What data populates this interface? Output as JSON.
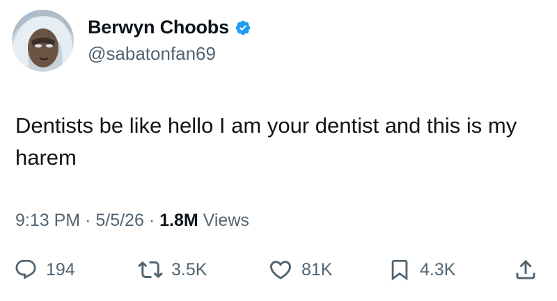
{
  "author": {
    "display_name": "Berwyn Choobs",
    "handle": "@sabatonfan69",
    "verified": true,
    "verified_color": "#1d9bf0"
  },
  "tweet": {
    "text": "Dentists be like hello I am your dentist and this is my harem"
  },
  "meta": {
    "time": "9:13 PM",
    "separator": "·",
    "date": "5/5/26",
    "views_count": "1.8M",
    "views_label": "Views"
  },
  "actions": {
    "replies": "194",
    "reposts": "3.5K",
    "likes": "81K",
    "bookmarks": "4.3K"
  },
  "colors": {
    "text": "#0f1419",
    "secondary": "#536471",
    "accent": "#1d9bf0"
  },
  "icons": [
    "reply-icon",
    "repost-icon",
    "like-icon",
    "bookmark-icon",
    "share-icon"
  ]
}
